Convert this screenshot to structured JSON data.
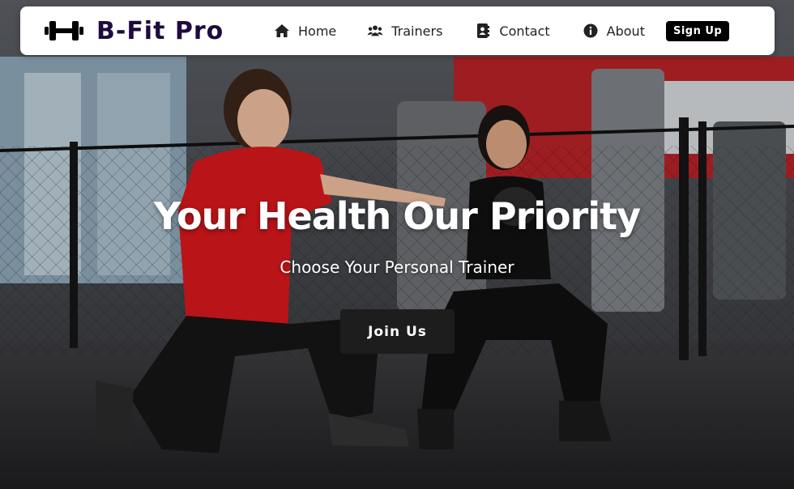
{
  "brand": {
    "name": "B-Fit Pro",
    "logo_icon": "dumbbell-icon"
  },
  "nav": {
    "items": [
      {
        "label": "Home",
        "icon": "home-icon"
      },
      {
        "label": "Trainers",
        "icon": "users-icon"
      },
      {
        "label": "Contact",
        "icon": "address-book-icon"
      },
      {
        "label": "About",
        "icon": "info-icon"
      }
    ],
    "signup_label": "Sign Up"
  },
  "hero": {
    "headline": "Your Health Our Priority",
    "subheadline": "Choose Your Personal Trainer",
    "cta_label": "Join Us",
    "image": "gym-trainer-photo"
  },
  "colors": {
    "brand_text": "#1f0a3f",
    "navbar_bg": "#ffffff",
    "button_dark": "#1d1d1d",
    "signup_bg": "#000000"
  }
}
